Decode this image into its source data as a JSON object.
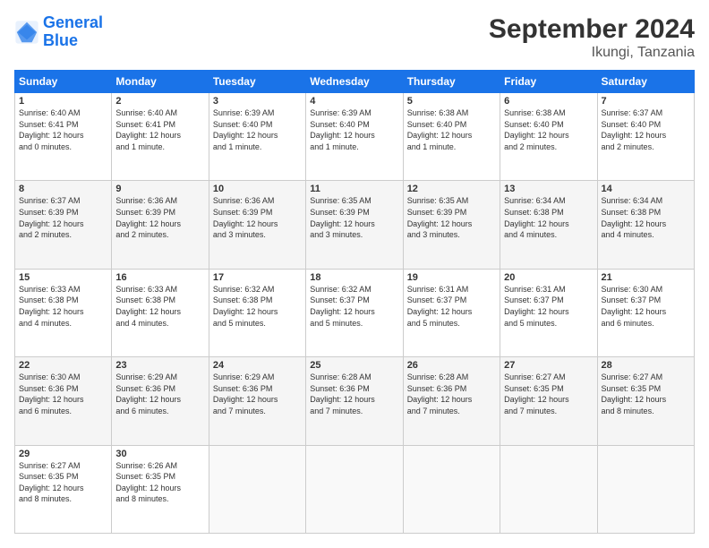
{
  "header": {
    "logo_line1": "General",
    "logo_line2": "Blue",
    "month_title": "September 2024",
    "subtitle": "Ikungi, Tanzania"
  },
  "weekdays": [
    "Sunday",
    "Monday",
    "Tuesday",
    "Wednesday",
    "Thursday",
    "Friday",
    "Saturday"
  ],
  "weeks": [
    [
      {
        "day": 1,
        "info": "Sunrise: 6:40 AM\nSunset: 6:41 PM\nDaylight: 12 hours\nand 0 minutes."
      },
      {
        "day": 2,
        "info": "Sunrise: 6:40 AM\nSunset: 6:41 PM\nDaylight: 12 hours\nand 1 minute."
      },
      {
        "day": 3,
        "info": "Sunrise: 6:39 AM\nSunset: 6:40 PM\nDaylight: 12 hours\nand 1 minute."
      },
      {
        "day": 4,
        "info": "Sunrise: 6:39 AM\nSunset: 6:40 PM\nDaylight: 12 hours\nand 1 minute."
      },
      {
        "day": 5,
        "info": "Sunrise: 6:38 AM\nSunset: 6:40 PM\nDaylight: 12 hours\nand 1 minute."
      },
      {
        "day": 6,
        "info": "Sunrise: 6:38 AM\nSunset: 6:40 PM\nDaylight: 12 hours\nand 2 minutes."
      },
      {
        "day": 7,
        "info": "Sunrise: 6:37 AM\nSunset: 6:40 PM\nDaylight: 12 hours\nand 2 minutes."
      }
    ],
    [
      {
        "day": 8,
        "info": "Sunrise: 6:37 AM\nSunset: 6:39 PM\nDaylight: 12 hours\nand 2 minutes."
      },
      {
        "day": 9,
        "info": "Sunrise: 6:36 AM\nSunset: 6:39 PM\nDaylight: 12 hours\nand 2 minutes."
      },
      {
        "day": 10,
        "info": "Sunrise: 6:36 AM\nSunset: 6:39 PM\nDaylight: 12 hours\nand 3 minutes."
      },
      {
        "day": 11,
        "info": "Sunrise: 6:35 AM\nSunset: 6:39 PM\nDaylight: 12 hours\nand 3 minutes."
      },
      {
        "day": 12,
        "info": "Sunrise: 6:35 AM\nSunset: 6:39 PM\nDaylight: 12 hours\nand 3 minutes."
      },
      {
        "day": 13,
        "info": "Sunrise: 6:34 AM\nSunset: 6:38 PM\nDaylight: 12 hours\nand 4 minutes."
      },
      {
        "day": 14,
        "info": "Sunrise: 6:34 AM\nSunset: 6:38 PM\nDaylight: 12 hours\nand 4 minutes."
      }
    ],
    [
      {
        "day": 15,
        "info": "Sunrise: 6:33 AM\nSunset: 6:38 PM\nDaylight: 12 hours\nand 4 minutes."
      },
      {
        "day": 16,
        "info": "Sunrise: 6:33 AM\nSunset: 6:38 PM\nDaylight: 12 hours\nand 4 minutes."
      },
      {
        "day": 17,
        "info": "Sunrise: 6:32 AM\nSunset: 6:38 PM\nDaylight: 12 hours\nand 5 minutes."
      },
      {
        "day": 18,
        "info": "Sunrise: 6:32 AM\nSunset: 6:37 PM\nDaylight: 12 hours\nand 5 minutes."
      },
      {
        "day": 19,
        "info": "Sunrise: 6:31 AM\nSunset: 6:37 PM\nDaylight: 12 hours\nand 5 minutes."
      },
      {
        "day": 20,
        "info": "Sunrise: 6:31 AM\nSunset: 6:37 PM\nDaylight: 12 hours\nand 5 minutes."
      },
      {
        "day": 21,
        "info": "Sunrise: 6:30 AM\nSunset: 6:37 PM\nDaylight: 12 hours\nand 6 minutes."
      }
    ],
    [
      {
        "day": 22,
        "info": "Sunrise: 6:30 AM\nSunset: 6:36 PM\nDaylight: 12 hours\nand 6 minutes."
      },
      {
        "day": 23,
        "info": "Sunrise: 6:29 AM\nSunset: 6:36 PM\nDaylight: 12 hours\nand 6 minutes."
      },
      {
        "day": 24,
        "info": "Sunrise: 6:29 AM\nSunset: 6:36 PM\nDaylight: 12 hours\nand 7 minutes."
      },
      {
        "day": 25,
        "info": "Sunrise: 6:28 AM\nSunset: 6:36 PM\nDaylight: 12 hours\nand 7 minutes."
      },
      {
        "day": 26,
        "info": "Sunrise: 6:28 AM\nSunset: 6:36 PM\nDaylight: 12 hours\nand 7 minutes."
      },
      {
        "day": 27,
        "info": "Sunrise: 6:27 AM\nSunset: 6:35 PM\nDaylight: 12 hours\nand 7 minutes."
      },
      {
        "day": 28,
        "info": "Sunrise: 6:27 AM\nSunset: 6:35 PM\nDaylight: 12 hours\nand 8 minutes."
      }
    ],
    [
      {
        "day": 29,
        "info": "Sunrise: 6:27 AM\nSunset: 6:35 PM\nDaylight: 12 hours\nand 8 minutes."
      },
      {
        "day": 30,
        "info": "Sunrise: 6:26 AM\nSunset: 6:35 PM\nDaylight: 12 hours\nand 8 minutes."
      },
      null,
      null,
      null,
      null,
      null
    ]
  ]
}
